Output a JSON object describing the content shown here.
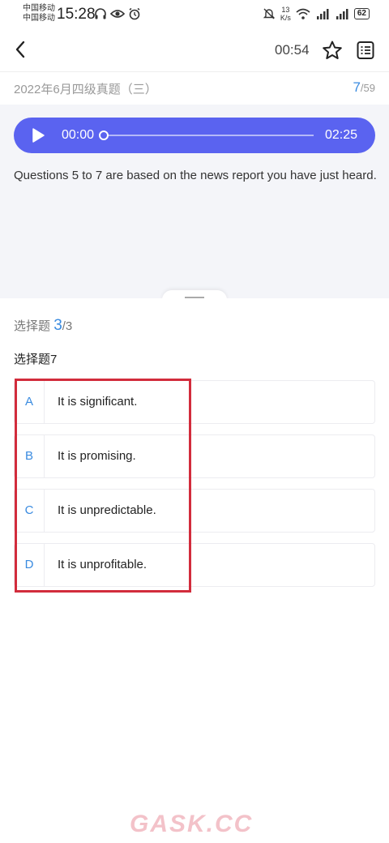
{
  "status_bar": {
    "carrier1": "中国移动",
    "carrier2": "中国移动",
    "time": "15:28",
    "net_speed_value": "13",
    "net_speed_unit": "K/s",
    "battery": "62"
  },
  "header": {
    "timer": "00:54"
  },
  "exam": {
    "title": "2022年6月四级真题（三）",
    "current_index": "7",
    "total": "/59"
  },
  "audio": {
    "current_time": "00:00",
    "total_time": "02:25",
    "progress": 0
  },
  "passage": {
    "text": "Questions 5 to 7 are based on the news report you have just heard."
  },
  "question": {
    "type_label": "选择题",
    "index": "3",
    "total": "/3",
    "title": "选择题7",
    "options": [
      {
        "letter": "A",
        "text": "It is significant."
      },
      {
        "letter": "B",
        "text": "It is promising."
      },
      {
        "letter": "C",
        "text": "It is unpredictable."
      },
      {
        "letter": "D",
        "text": "It is unprofitable."
      }
    ]
  },
  "watermark": "GASK.CC",
  "colors": {
    "accent": "#5a63f0",
    "link_blue": "#3a8be0",
    "highlight_red": "#d22c3c"
  }
}
